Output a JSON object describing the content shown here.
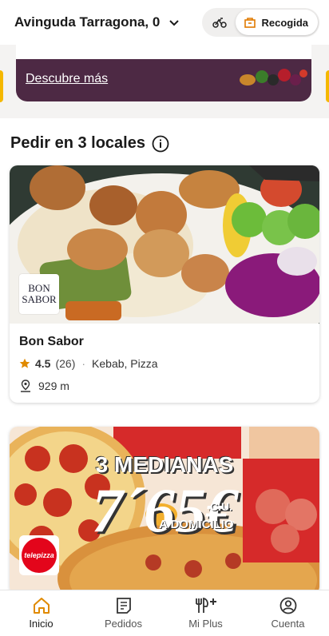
{
  "header": {
    "address": "Avinguda Tarragona, 0",
    "delivery_mode_icon": "bike-icon",
    "pickup_label": "Recogida"
  },
  "promo": {
    "link_text": "Descubre más"
  },
  "section": {
    "title": "Pedir en 3 locales"
  },
  "stores": [
    {
      "name": "Bon Sabor",
      "logo_text": "BON SABOR",
      "rating": "4.5",
      "reviews": "(26)",
      "categories": "Kebab, Pizza",
      "distance": "929 m"
    },
    {
      "name": "Telepizza",
      "logo_text": "telepizza",
      "promo_line1": "3 MEDIANAS",
      "promo_price": "7´65€",
      "promo_unit": "C.U.",
      "promo_line3": "A DOMICILIO"
    }
  ],
  "nav": {
    "items": [
      {
        "label": "Inicio",
        "icon": "home-icon",
        "active": true
      },
      {
        "label": "Pedidos",
        "icon": "orders-icon",
        "active": false
      },
      {
        "label": "Mi Plus",
        "icon": "plus-icon",
        "active": false
      },
      {
        "label": "Cuenta",
        "icon": "account-icon",
        "active": false
      }
    ]
  },
  "colors": {
    "accent": "#f5b800",
    "promo_bg": "#4d2944",
    "star": "#e08a00",
    "telepizza_red": "#e3051b"
  }
}
